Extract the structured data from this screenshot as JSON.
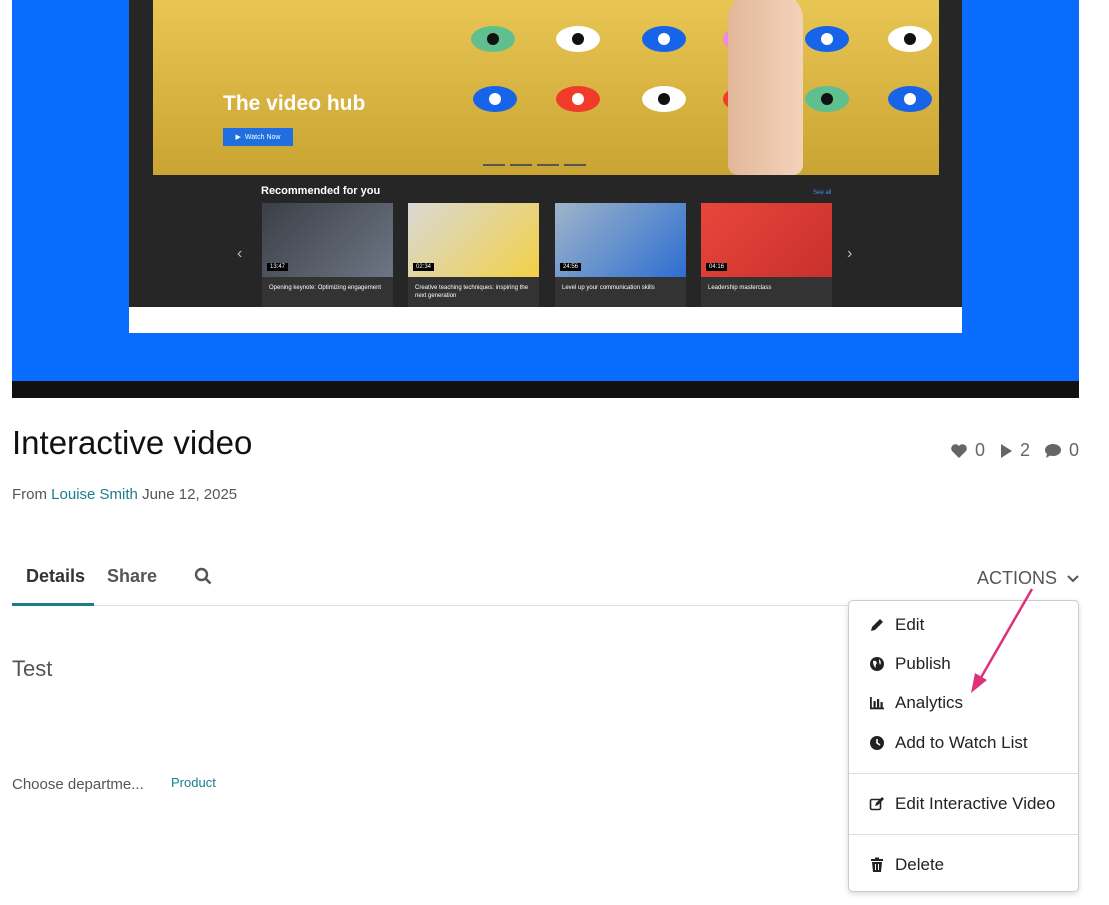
{
  "player": {
    "hero_title": "The video hub",
    "watch_now": "Watch Now",
    "recommended": "Recommended for you",
    "see_all": "See all",
    "cards": [
      {
        "duration": "13:47",
        "caption": "Opening keynote: Optimizing engagement"
      },
      {
        "duration": "02:34",
        "caption": "Creative teaching techniques: inspiring the next generation"
      },
      {
        "duration": "24:56",
        "caption": "Level up your communication skills"
      },
      {
        "duration": "04:16",
        "caption": "Leadership masterclass"
      }
    ]
  },
  "media": {
    "title": "Interactive video",
    "from_label": "From",
    "author": "Louise Smith",
    "date": "June 12, 2025",
    "likes": "0",
    "plays": "2",
    "comments": "0"
  },
  "tabs": {
    "details": "Details",
    "share": "Share",
    "actions": "ACTIONS"
  },
  "details": {
    "description": "Test",
    "field_label": "Choose departme...",
    "field_value": "Product"
  },
  "menu": {
    "edit": "Edit",
    "publish": "Publish",
    "analytics": "Analytics",
    "watch_list": "Add to Watch List",
    "edit_interactive": "Edit Interactive Video",
    "delete": "Delete"
  },
  "colors": {
    "accent": "#1a7d8c",
    "annotation": "#e0307a",
    "player_bg": "#0a6cff"
  }
}
